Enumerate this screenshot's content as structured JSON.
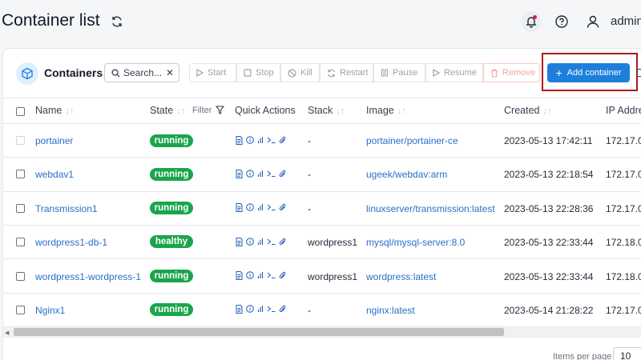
{
  "header": {
    "title": "Container list",
    "user": "admin",
    "icons": [
      "refresh-icon",
      "bell-icon",
      "help-icon",
      "user-icon"
    ]
  },
  "panel": {
    "title": "Containers",
    "search_placeholder": "Search...",
    "toolbar": {
      "start": "Start",
      "stop": "Stop",
      "kill": "Kill",
      "restart": "Restart",
      "pause": "Pause",
      "resume": "Resume",
      "remove": "Remove",
      "add": "Add container"
    }
  },
  "table": {
    "columns": {
      "name": "Name",
      "state": "State",
      "filter": "Filter",
      "quick_actions": "Quick Actions",
      "stack": "Stack",
      "image": "Image",
      "created": "Created",
      "ip": "IP Addre"
    },
    "rows": [
      {
        "name": "portainer",
        "state": "running",
        "stack": "-",
        "image": "portainer/portainer-ce",
        "created": "2023-05-13 17:42:11",
        "ip": "172.17.0."
      },
      {
        "name": "webdav1",
        "state": "running",
        "stack": "-",
        "image": "ugeek/webdav:arm",
        "created": "2023-05-13 22:18:54",
        "ip": "172.17.0."
      },
      {
        "name": "Transmission1",
        "state": "running",
        "stack": "-",
        "image": "linuxserver/transmission:latest",
        "created": "2023-05-13 22:28:36",
        "ip": "172.17.0."
      },
      {
        "name": "wordpress1-db-1",
        "state": "healthy",
        "stack": "wordpress1",
        "image": "mysql/mysql-server:8.0",
        "created": "2023-05-13 22:33:44",
        "ip": "172.18.0."
      },
      {
        "name": "wordpress1-wordpress-1",
        "state": "running",
        "stack": "wordpress1",
        "image": "wordpress:latest",
        "created": "2023-05-13 22:33:44",
        "ip": "172.18.0."
      },
      {
        "name": "Nginx1",
        "state": "running",
        "stack": "-",
        "image": "nginx:latest",
        "created": "2023-05-14 21:28:22",
        "ip": "172.17.0."
      }
    ]
  },
  "footer": {
    "items_per_page_label": "Items per page",
    "items_per_page": "10"
  },
  "colors": {
    "primary": "#1d7fdb",
    "badge_green": "#1aa54d",
    "link": "#2a6fc9",
    "highlight": "#b5171d"
  }
}
